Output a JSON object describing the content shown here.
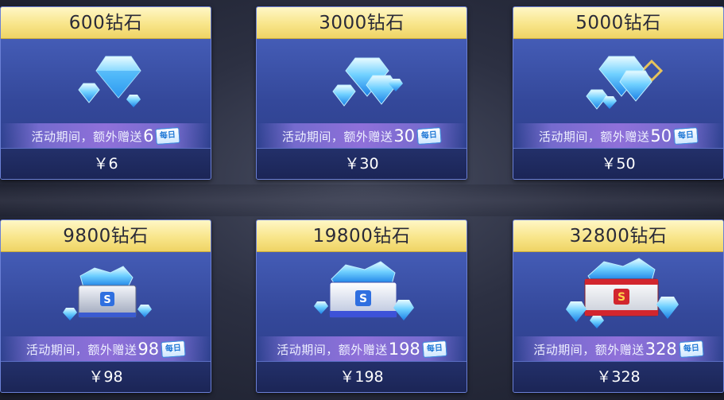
{
  "shop": {
    "items": [
      {
        "title": "600钻石",
        "bonus_label": "活动期间，额外赠送",
        "bonus_amount": "6",
        "tag": "每日",
        "price": "￥6",
        "art": "small-diamond-pile"
      },
      {
        "title": "3000钻石",
        "bonus_label": "活动期间，额外赠送",
        "bonus_amount": "30",
        "tag": "每日",
        "price": "￥30",
        "art": "diamond-cluster"
      },
      {
        "title": "5000钻石",
        "bonus_label": "活动期间，额外赠送",
        "bonus_amount": "50",
        "tag": "每日",
        "price": "￥50",
        "art": "diamond-pile-gold"
      },
      {
        "title": "9800钻石",
        "bonus_label": "活动期间，额外赠送",
        "bonus_amount": "98",
        "tag": "每日",
        "price": "￥98",
        "art": "silver-chest"
      },
      {
        "title": "19800钻石",
        "bonus_label": "活动期间，额外赠送",
        "bonus_amount": "198",
        "tag": "每日",
        "price": "￥198",
        "art": "blue-chest"
      },
      {
        "title": "32800钻石",
        "bonus_label": "活动期间，额外赠送",
        "bonus_amount": "328",
        "tag": "每日",
        "price": "￥328",
        "art": "red-chest"
      }
    ]
  },
  "colors": {
    "header_gold": "#f8e58a",
    "card_blue": "#34489a",
    "price_bar": "#1b2556",
    "bonus_purple": "#a078e6"
  }
}
